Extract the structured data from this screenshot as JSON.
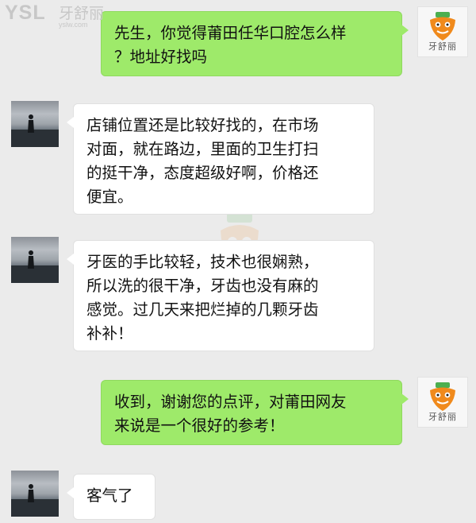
{
  "watermark": {
    "logo": "YSL",
    "brand": "牙舒丽",
    "url": "yslw.com"
  },
  "brand_avatar": {
    "label": "牙舒丽",
    "icon": "carrot-mascot-icon",
    "color": "#f08a1c"
  },
  "colors": {
    "sent_bubble": "#9eea6a",
    "received_bubble": "#ffffff",
    "background": "#ebebeb"
  },
  "messages": [
    {
      "sender": "me",
      "lines": [
        "先生，你觉得莆田任华口腔怎么样",
        "？地址好找吗"
      ]
    },
    {
      "sender": "them",
      "lines": [
        "店铺位置还是比较好找的，在市场",
        "对面，就在路边，里面的卫生打扫",
        "的挺干净，态度超级好啊，价格还",
        "便宜。"
      ]
    },
    {
      "sender": "them",
      "lines": [
        "牙医的手比较轻，技术也很娴熟，",
        "所以洗的很干净，牙齿也没有麻的",
        "感觉。过几天来把烂掉的几颗牙齿",
        "补补！"
      ]
    },
    {
      "sender": "me",
      "lines": [
        "收到，谢谢您的点评，对莆田网友",
        "来说是一个很好的参考！"
      ]
    },
    {
      "sender": "them",
      "lines": [
        "客气了"
      ]
    }
  ]
}
